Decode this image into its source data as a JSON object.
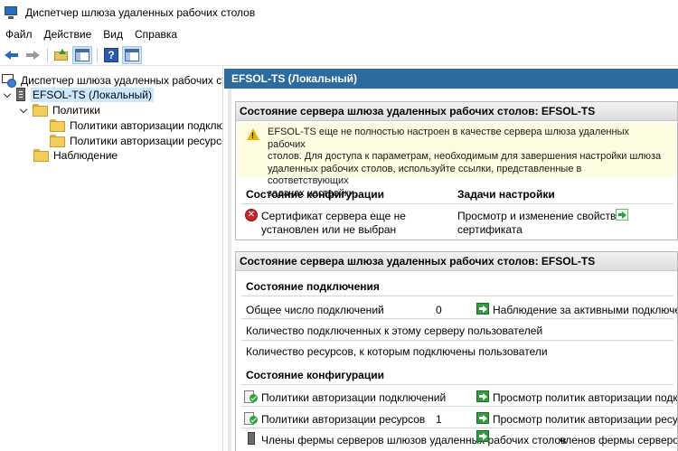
{
  "window": {
    "title": "Диспетчер шлюза удаленных рабочих столов"
  },
  "menu": {
    "items": [
      "Файл",
      "Действие",
      "Вид",
      "Справка"
    ]
  },
  "toolbar": {
    "buttons": [
      "back-icon",
      "forward-icon",
      "up-folder-icon",
      "show-hide-tree-icon",
      "help-icon",
      "properties-icon"
    ]
  },
  "tree": {
    "root": "Диспетчер шлюза удаленных рабочих сто",
    "server": "EFSOL-TS (Локальный)",
    "policies": "Политики",
    "cap": "Политики авторизации подключ",
    "rap": "Политики авторизации ресурсов",
    "monitoring": "Наблюдение"
  },
  "right": {
    "header": "EFSOL-TS (Локальный)",
    "section1": {
      "title": "Состояние сервера шлюза удаленных рабочих столов: EFSOL-TS",
      "warning_lines": [
        "EFSOL-TS еще не полностью настроен в качестве сервера шлюза удаленных рабочих",
        "столов. Для доступа к параметрам, необходимым для завершения настройки шлюза",
        "удаленных рабочих столов, используйте ссылки, представленные в соответствующих",
        "задачах настройки."
      ],
      "col_status": "Состояние конфигурации",
      "col_tasks": "Задачи настройки",
      "cert_status_line1": "Сертификат сервера еще не",
      "cert_status_line2": "установлен или не выбран",
      "cert_task_line1": "Просмотр и изменение свойств",
      "cert_task_line2": "сертификата"
    },
    "section2": {
      "title": "Состояние сервера шлюза удаленных рабочих столов: EFSOL-TS",
      "conn_head": "Состояние подключения",
      "total_label": "Общее число подключений",
      "total_value": "0",
      "monitor_link": "Наблюдение за активными подключе",
      "users_label": "Количество подключенных к этому серверу пользователей",
      "resources_label": "Количество ресурсов, к которым подключены пользователи",
      "config_head": "Состояние конфигурации",
      "cap_label": "Политики авторизации подключений",
      "cap_link": "Просмотр политик авторизации подкл",
      "rap_label": "Политики авторизации ресурсов",
      "rap_value": "1",
      "rap_link": "Просмотр политик авторизации ресур",
      "farm_label": "Члены фермы серверов шлюзов удаленных рабочих столов",
      "farm_link": "членов фермы серверов"
    }
  },
  "colors": {
    "header_blue": "#2c6b9e",
    "warning_bg": "#fdfbe0",
    "selection": "#cce8ff"
  }
}
